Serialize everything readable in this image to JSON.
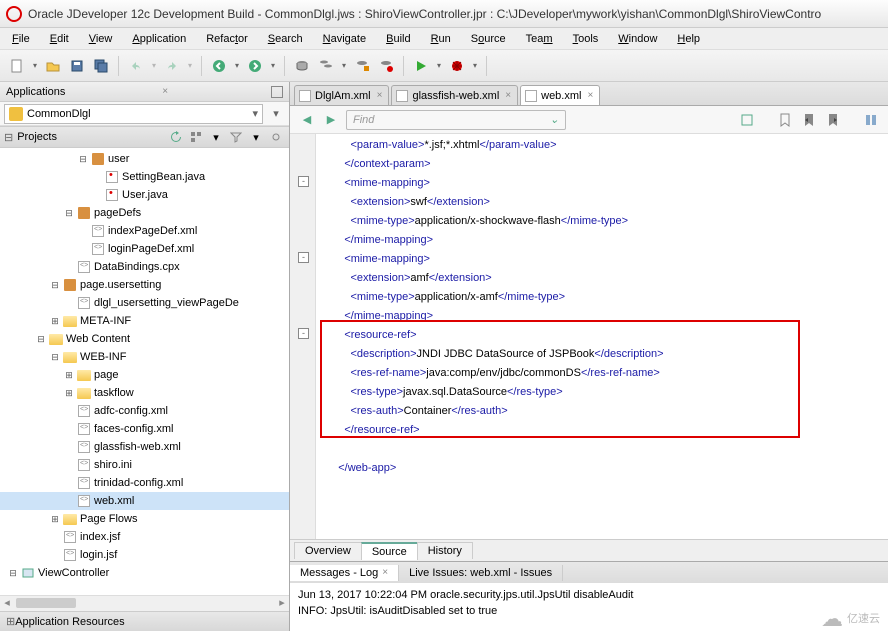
{
  "window": {
    "title": "Oracle JDeveloper 12c Development Build - CommonDlgl.jws : ShiroViewController.jpr : C:\\JDeveloper\\mywork\\yishan\\CommonDlgl\\ShiroViewContro"
  },
  "menu": {
    "file": "File",
    "edit": "Edit",
    "view": "View",
    "application": "Application",
    "refactor": "Refactor",
    "search": "Search",
    "navigate": "Navigate",
    "build": "Build",
    "run": "Run",
    "source": "Source",
    "team": "Team",
    "tools": "Tools",
    "window": "Window",
    "help": "Help"
  },
  "apps": {
    "header": "Applications",
    "selected": "CommonDlgl"
  },
  "projects": {
    "label": "Projects"
  },
  "tree": {
    "n0": "user",
    "n1": "SettingBean.java",
    "n2": "User.java",
    "n3": "pageDefs",
    "n4": "indexPageDef.xml",
    "n5": "loginPageDef.xml",
    "n6": "DataBindings.cpx",
    "n7": "page.usersetting",
    "n8": "dlgl_usersetting_viewPageDe",
    "n9": "META-INF",
    "n10": "Web Content",
    "n11": "WEB-INF",
    "n12": "page",
    "n13": "taskflow",
    "n14": "adfc-config.xml",
    "n15": "faces-config.xml",
    "n16": "glassfish-web.xml",
    "n17": "shiro.ini",
    "n18": "trinidad-config.xml",
    "n19": "web.xml",
    "n20": "Page Flows",
    "n21": "index.jsf",
    "n22": "login.jsf",
    "n23": "ViewController"
  },
  "appres": {
    "label": "Application Resources"
  },
  "editorTabs": {
    "t0": "DlglAm.xml",
    "t1": "glassfish-web.xml",
    "t2": "web.xml"
  },
  "find": {
    "placeholder": "Find"
  },
  "code": {
    "l0a": "<param-value>",
    "l0b": "*.jsf;*.xhtml",
    "l0c": "</param-value>",
    "l1": "</context-param>",
    "l2": "<mime-mapping>",
    "l3a": "<extension>",
    "l3b": "swf",
    "l3c": "</extension>",
    "l4a": "<mime-type>",
    "l4b": "application/x-shockwave-flash",
    "l4c": "</mime-type>",
    "l5": "</mime-mapping>",
    "l6": "<mime-mapping>",
    "l7a": "<extension>",
    "l7b": "amf",
    "l7c": "</extension>",
    "l8a": "<mime-type>",
    "l8b": "application/x-amf",
    "l8c": "</mime-type>",
    "l9": "</mime-mapping>",
    "l10": "<resource-ref>",
    "l11a": "<description>",
    "l11b": "JNDI JDBC DataSource of JSPBook",
    "l11c": "</description>",
    "l12a": "<res-ref-name>",
    "l12b": "java:comp/env/jdbc/commonDS",
    "l12c": "</res-ref-name>",
    "l13a": "<res-type>",
    "l13b": "javax.sql.DataSource",
    "l13c": "</res-type>",
    "l14a": "<res-auth>",
    "l14b": "Container",
    "l14c": "</res-auth>",
    "l15": "</resource-ref>",
    "l16": "</web-app>"
  },
  "bottomTabs": {
    "overview": "Overview",
    "source": "Source",
    "history": "History"
  },
  "msgTabs": {
    "t0": "Messages - Log",
    "t1": "Live Issues: web.xml - Issues"
  },
  "messages": {
    "l0": "Jun 13, 2017 10:22:04 PM oracle.security.jps.util.JpsUtil disableAudit",
    "l1": "INFO: JpsUtil: isAuditDisabled set to true"
  },
  "watermark": "亿速云"
}
